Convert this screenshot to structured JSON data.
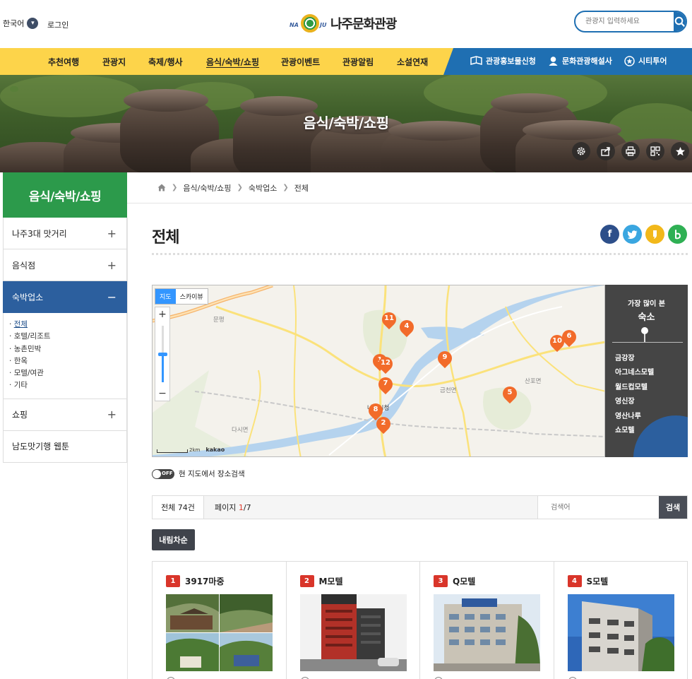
{
  "header": {
    "language": "한국어",
    "login": "로그인",
    "logo_prefix": "NA",
    "logo_suffix": "JU",
    "site_name": "나주문화관광",
    "search_placeholder": "관광지 입력하세요"
  },
  "nav": {
    "items": [
      {
        "label": "추천여행"
      },
      {
        "label": "관광지"
      },
      {
        "label": "축제/행사"
      },
      {
        "label": "음식/숙박/쇼핑",
        "active": true
      },
      {
        "label": "관광이벤트"
      },
      {
        "label": "관광알림"
      },
      {
        "label": "소설연재"
      }
    ],
    "utility": [
      {
        "label": "관광홍보물신청",
        "icon": "book-icon"
      },
      {
        "label": "문화관광해설사",
        "icon": "guide-icon"
      },
      {
        "label": "시티투어",
        "icon": "star-badge-icon"
      }
    ]
  },
  "hero": {
    "title": "음식/숙박/쇼핑",
    "tools": [
      "settings-icon",
      "share-icon",
      "print-icon",
      "qr-code-icon",
      "favorite-star-icon"
    ]
  },
  "sidebar": {
    "title": "음식/숙박/쇼핑",
    "items": [
      {
        "label": "나주3대 맛거리",
        "toggle": "+"
      },
      {
        "label": "음식점",
        "toggle": "+"
      },
      {
        "label": "숙박업소",
        "toggle": "−",
        "open": true
      },
      {
        "label": "쇼핑",
        "toggle": "+"
      },
      {
        "label": "남도맛기행 웹툰",
        "toggle": ""
      }
    ],
    "subitems": [
      "전체",
      "호텔/리조트",
      "농촌민박",
      "한옥",
      "모텔/여관",
      "기타"
    ]
  },
  "breadcrumb": [
    "음식/숙박/쇼핑",
    "숙박업소",
    "전체"
  ],
  "page_title": "전체",
  "map": {
    "type_map": "지도",
    "type_sky": "스카이뷰",
    "zoom_in": "+",
    "zoom_out": "−",
    "scale": "2km",
    "brand": "kakao",
    "place_labels": [
      "문평",
      "다시면",
      "금천면",
      "산포면",
      "나주시청"
    ],
    "pins": [
      "1",
      "2",
      "4",
      "5",
      "6",
      "7",
      "8",
      "9",
      "10",
      "11",
      "12"
    ]
  },
  "popular": {
    "line1": "가장 많이 본",
    "line2": "숙소",
    "items": [
      "금강장",
      "아그네스모텔",
      "월드컵모텔",
      "영신장",
      "영산나루",
      "쇼모텔"
    ]
  },
  "toggle": {
    "state": "OFF",
    "label": "현 지도에서 장소검색"
  },
  "listbar": {
    "total": "전체 74건",
    "page_prefix": "페이지 ",
    "page_current": "1",
    "page_total": "/7",
    "search_placeholder": "검색어",
    "search_button": "검색"
  },
  "sort_button": "내림차순",
  "cards": [
    {
      "no": "1",
      "name": "3917마중"
    },
    {
      "no": "2",
      "name": "M모텔"
    },
    {
      "no": "3",
      "name": "Q모텔"
    },
    {
      "no": "4",
      "name": "S모텔"
    }
  ],
  "colors": {
    "nav_yellow": "#fdd44a",
    "accent_blue": "#1f6fb2",
    "sidebar_green": "#2c9a4b",
    "active_blue": "#2c5f9e",
    "pin_orange": "#f26b2a",
    "badge_red": "#d9352a"
  }
}
